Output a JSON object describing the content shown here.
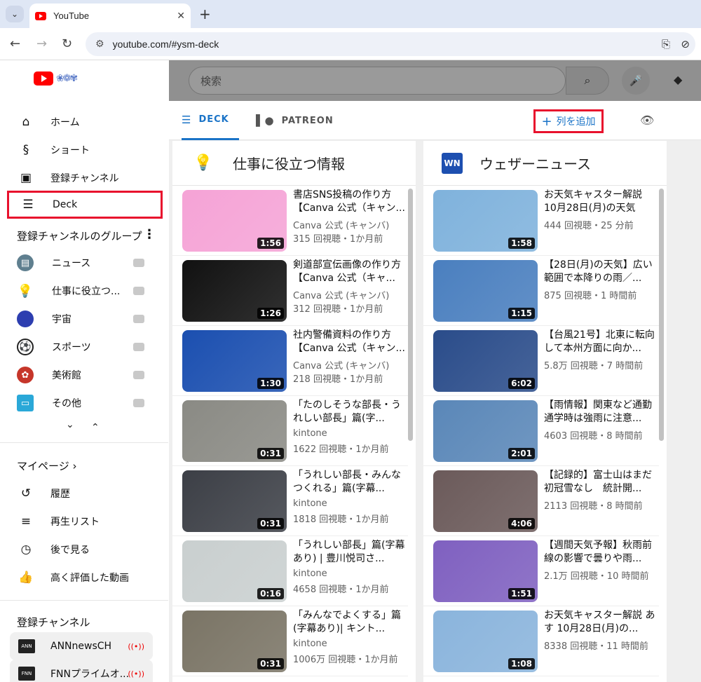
{
  "browser": {
    "tab_title": "YouTube",
    "url": "youtube.com/#ysm-deck"
  },
  "sidebar": {
    "nav": [
      {
        "label": "ホーム",
        "icon": "home-icon"
      },
      {
        "label": "ショート",
        "icon": "shorts-icon"
      },
      {
        "label": "登録チャンネル",
        "icon": "subscriptions-icon"
      },
      {
        "label": "Deck",
        "icon": "deck-icon"
      }
    ],
    "groups_heading": "登録チャンネルのグループ",
    "groups": [
      {
        "label": "ニュース",
        "icon": "news-icon",
        "color": "#5f7f8f"
      },
      {
        "label": "仕事に役立つ...",
        "icon": "lightbulb-icon",
        "color": "#f5c400"
      },
      {
        "label": "宇宙",
        "icon": "space-icon",
        "color": "#2d3eb0"
      },
      {
        "label": "スポーツ",
        "icon": "soccer-icon",
        "color": "#222222"
      },
      {
        "label": "美術館",
        "icon": "art-icon",
        "color": "#c6362a"
      },
      {
        "label": "その他",
        "icon": "tv-icon",
        "color": "#2aa8d8"
      }
    ],
    "mypage_heading": "マイページ",
    "mypage": [
      {
        "label": "履歴",
        "icon": "history-icon"
      },
      {
        "label": "再生リスト",
        "icon": "playlist-icon"
      },
      {
        "label": "後で見る",
        "icon": "watch-later-icon"
      },
      {
        "label": "高く評価した動画",
        "icon": "like-icon"
      }
    ],
    "subs_heading": "登録チャンネル",
    "subs": [
      {
        "label": "ANNnewsCH",
        "icon_text": "ANN"
      },
      {
        "label": "FNNプライムオ...",
        "icon_text": "FNN"
      }
    ]
  },
  "search": {
    "placeholder": "検索"
  },
  "deck_tabs": [
    {
      "label": "DECK",
      "icon": "deck-icon"
    },
    {
      "label": "PATREON",
      "icon": "patreon-icon"
    }
  ],
  "add_column_label": "列を追加",
  "columns": [
    {
      "title": "仕事に役立つ情報",
      "icon": "lightbulb-icon",
      "videos": [
        {
          "title": "書店SNS投稿の作り方【Canva 公式（キャン...",
          "channel": "Canva 公式 (キャンバ)",
          "meta": "315 回視聴・1か月前",
          "duration": "1:56",
          "thumb": "#f5a3d6"
        },
        {
          "title": "剣道部宣伝画像の作り方【Canva 公式（キャ...",
          "channel": "Canva 公式 (キャンバ)",
          "meta": "312 回視聴・1か月前",
          "duration": "1:26",
          "thumb": "#111111"
        },
        {
          "title": "社内警備資料の作り方【Canva 公式（キャン...",
          "channel": "Canva 公式 (キャンバ)",
          "meta": "218 回視聴・1か月前",
          "duration": "1:30",
          "thumb": "#1b4fb0"
        },
        {
          "title": "「たのしそうな部長・うれしい部長」篇(字...",
          "channel": "kintone",
          "meta": "1622 回視聴・1か月前",
          "duration": "0:31",
          "thumb": "#8a8a84"
        },
        {
          "title": "「うれしい部長・みんなつくれる」篇(字幕...",
          "channel": "kintone",
          "meta": "1818 回視聴・1か月前",
          "duration": "0:31",
          "thumb": "#3c3f46"
        },
        {
          "title": "「うれしい部長」篇(字幕あり) | 豊川悦司さ...",
          "channel": "kintone",
          "meta": "4658 回視聴・1か月前",
          "duration": "0:16",
          "thumb": "#c9cfcf"
        },
        {
          "title": "「みんなでよくする」篇 (字幕あり)| キント...",
          "channel": "kintone",
          "meta": "1006万 回視聴・1か月前",
          "duration": "0:31",
          "thumb": "#7a7465"
        }
      ]
    },
    {
      "title": "ウェザーニュース",
      "icon": "weathernews-icon",
      "videos": [
        {
          "title": "お天気キャスター解説 10月28日(月)の天気",
          "channel": "",
          "meta": "444 回視聴・25 分前",
          "duration": "1:58",
          "thumb": "#7fb2dc"
        },
        {
          "title": "【28日(月)の天気】広い範囲で本降りの雨／...",
          "channel": "",
          "meta": "875 回視聴・1 時間前",
          "duration": "1:15",
          "thumb": "#4a7fbf"
        },
        {
          "title": "【台風21号】北東に転向して本州方面に向か...",
          "channel": "",
          "meta": "5.8万 回視聴・7 時間前",
          "duration": "6:02",
          "thumb": "#2a4c8a"
        },
        {
          "title": "【雨情報】関東など通勤通学時は強雨に注意...",
          "channel": "",
          "meta": "4603 回視聴・8 時間前",
          "duration": "2:01",
          "thumb": "#5a87b8"
        },
        {
          "title": "【記録的】富士山はまだ初冠雪なし　統計開...",
          "channel": "",
          "meta": "2113 回視聴・8 時間前",
          "duration": "4:06",
          "thumb": "#6b5a5a"
        },
        {
          "title": "【週間天気予報】秋雨前線の影響で曇りや雨...",
          "channel": "",
          "meta": "2.1万 回視聴・10 時間前",
          "duration": "1:51",
          "thumb": "#7f60c0"
        },
        {
          "title": "お天気キャスター解説 あす 10月28日(月)の...",
          "channel": "",
          "meta": "8338 回視聴・11 時間前",
          "duration": "1:08",
          "thumb": "#8ab4dc"
        }
      ]
    }
  ]
}
